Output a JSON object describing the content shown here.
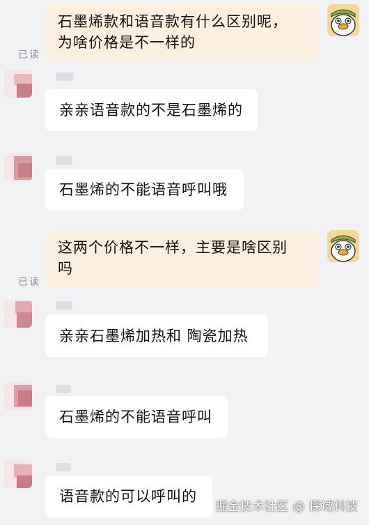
{
  "chat": {
    "read_status": "已读",
    "messages": [
      {
        "side": "out",
        "text": "石墨烯款和语音款有什么区别呢，\n为啥价格是不一样的"
      },
      {
        "side": "in",
        "text": "亲亲语音款的不是石墨烯的"
      },
      {
        "side": "in",
        "text": "石墨烯的不能语音呼叫哦"
      },
      {
        "side": "out",
        "text": "这两个价格不一样，主要是啥区别\n吗"
      },
      {
        "side": "in",
        "text": "亲亲石墨烯加热和 陶瓷加热"
      },
      {
        "side": "in",
        "text": "石墨烯的不能语音呼叫"
      },
      {
        "side": "in",
        "text": "语音款的可以呼叫的"
      }
    ]
  },
  "watermark": {
    "text": "掘金技术社区 @ 探域科技"
  },
  "colors": {
    "background": "#f1f2f4",
    "outgoing_bubble": "#fbefdf",
    "incoming_bubble": "#ffffff",
    "avatar_blur": "#c97d86"
  }
}
